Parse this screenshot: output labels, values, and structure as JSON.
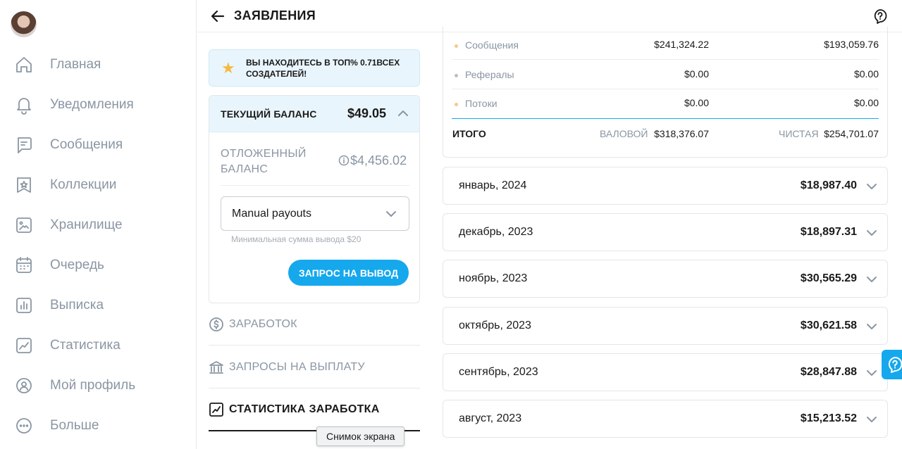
{
  "sidebar": {
    "items": [
      {
        "label": "Главная",
        "icon": "home-icon"
      },
      {
        "label": "Уведомления",
        "icon": "bell-icon"
      },
      {
        "label": "Сообщения",
        "icon": "message-icon"
      },
      {
        "label": "Коллекции",
        "icon": "bookmark-icon"
      },
      {
        "label": "Хранилище",
        "icon": "image-icon"
      },
      {
        "label": "Очередь",
        "icon": "calendar-icon"
      },
      {
        "label": "Выписка",
        "icon": "bar-chart-icon"
      },
      {
        "label": "Статистика",
        "icon": "line-chart-icon"
      },
      {
        "label": "Мой профиль",
        "icon": "profile-icon"
      },
      {
        "label": "Больше",
        "icon": "more-icon"
      }
    ]
  },
  "header": {
    "title": "ЗАЯВЛЕНИЯ"
  },
  "badge": {
    "text": "ВЫ НАХОДИТЕСЬ В ТОП% 0.71ВСЕХ СОЗДАТЕЛЕЙ!"
  },
  "balance": {
    "current_label": "ТЕКУЩИЙ БАЛАНС",
    "current_value": "$49.05",
    "pending_label": "ОТЛОЖЕННЫЙ БАЛАНС",
    "pending_value": "$4,456.02",
    "payout_mode": "Manual payouts",
    "min_note": "Минимальная сумма вывода $20",
    "withdraw_label": "ЗАПРОС НА ВЫВОД"
  },
  "links": {
    "earnings": "ЗАРАБОТОК",
    "payout_requests": "ЗАПРОСЫ НА ВЫПЛАТУ",
    "earnings_stats": "СТАТИСТИКА ЗАРАБОТКА"
  },
  "summary": {
    "rows": [
      {
        "name": "Сообщения",
        "gross": "$241,324.22",
        "net": "$193,059.76",
        "dot_color": "#f5c98a"
      },
      {
        "name": "Рефералы",
        "gross": "$0.00",
        "net": "$0.00",
        "dot_color": "#b8bfc6"
      },
      {
        "name": "Потоки",
        "gross": "$0.00",
        "net": "$0.00",
        "dot_color": "#f5c98a"
      }
    ],
    "total_label": "ИТОГО",
    "gross_label": "ВАЛОВОЙ",
    "gross_total": "$318,376.07",
    "net_label": "ЧИСТАЯ",
    "net_total": "$254,701.07"
  },
  "months": [
    {
      "month": "январь, 2024",
      "amount": "$18,987.40"
    },
    {
      "month": "декабрь, 2023",
      "amount": "$18,897.31"
    },
    {
      "month": "ноябрь, 2023",
      "amount": "$30,565.29"
    },
    {
      "month": "октябрь, 2023",
      "amount": "$30,621.58"
    },
    {
      "month": "сентябрь, 2023",
      "amount": "$28,847.88"
    },
    {
      "month": "август, 2023",
      "amount": "$15,213.52"
    }
  ],
  "tooltip": "Снимок экрана",
  "colors": {
    "accent": "#16a8ec",
    "muted": "#8a96a3",
    "badge_bg": "#e9f5fc"
  }
}
